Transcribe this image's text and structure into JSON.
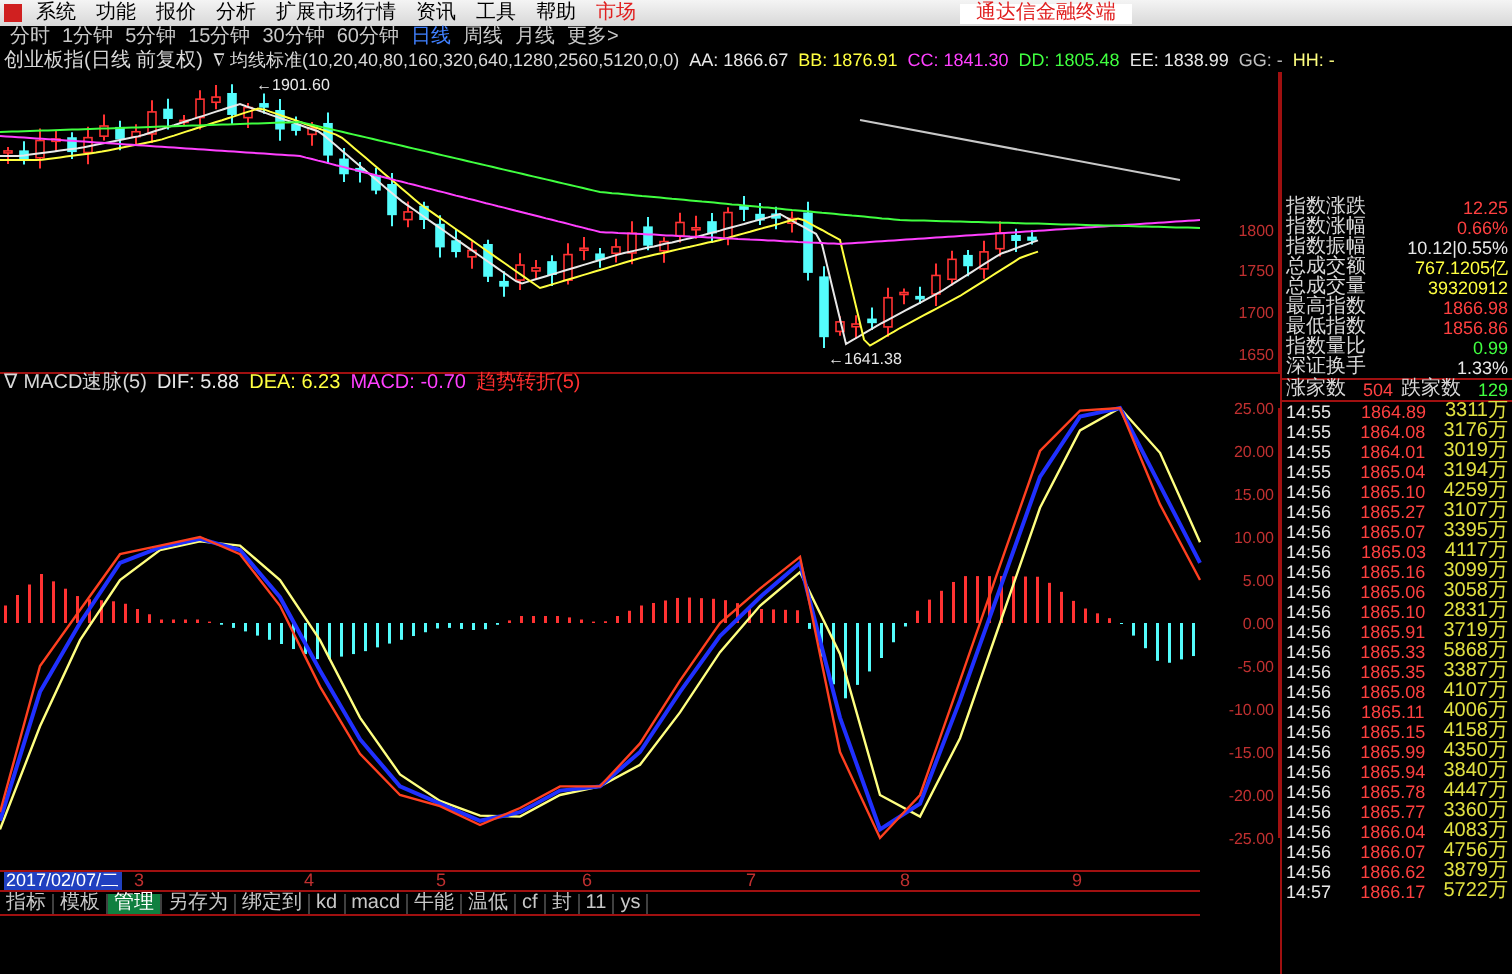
{
  "menu": [
    {
      "label": "系统"
    },
    {
      "label": "功能"
    },
    {
      "label": "报价"
    },
    {
      "label": "分析"
    },
    {
      "label": "扩展市场行情"
    },
    {
      "label": "资讯"
    },
    {
      "label": "工具"
    },
    {
      "label": "帮助"
    }
  ],
  "menu_badge": "市场",
  "brand": "通达信金融终端",
  "periods": [
    {
      "label": "分时",
      "selected": false
    },
    {
      "label": "1分钟",
      "selected": false
    },
    {
      "label": "5分钟",
      "selected": false
    },
    {
      "label": "15分钟",
      "selected": false
    },
    {
      "label": "30分钟",
      "selected": false
    },
    {
      "label": "60分钟",
      "selected": false
    },
    {
      "label": "日线",
      "selected": true
    },
    {
      "label": "周线",
      "selected": false
    },
    {
      "label": "月线",
      "selected": false
    },
    {
      "label": "更多>",
      "selected": false
    }
  ],
  "main_header": {
    "title": "创业板指(日线 前复权)",
    "indicator": "∇ 均线标准(10,20,40,80,160,320,640,1280,2560,5120,0,0)",
    "values": [
      {
        "text": "AA: 1866.67",
        "color": "#e8e8e8"
      },
      {
        "text": "BB: 1876.91",
        "color": "#ffff40"
      },
      {
        "text": "CC: 1841.30",
        "color": "#ff40ff"
      },
      {
        "text": "DD: 1805.48",
        "color": "#40ff40"
      },
      {
        "text": "EE: 1838.99",
        "color": "#e8e8e8"
      },
      {
        "text": "GG: -",
        "color": "#c0c0c0"
      },
      {
        "text": "HH: -",
        "color": "#ffff80"
      }
    ]
  },
  "main_chart": {
    "yticks": [
      "1800",
      "1750",
      "1700",
      "1650"
    ],
    "high_label": "←1901.60",
    "low_label": "←1641.38"
  },
  "macd_header": {
    "title": "∇ MACD速脉(5)",
    "values": [
      {
        "text": "DIF: 5.88",
        "color": "#e8e8e8"
      },
      {
        "text": "DEA: 6.23",
        "color": "#ffff40"
      },
      {
        "text": "MACD: -0.70",
        "color": "#ff40ff"
      },
      {
        "text": "趋势转折(5)",
        "color": "#ff3030"
      }
    ]
  },
  "macd_chart": {
    "chart_data": {
      "type": "line",
      "ylim": [
        -25,
        25
      ],
      "yticks": [
        {
          "value": 25,
          "label": "25.00"
        },
        {
          "value": 20,
          "label": "20.00"
        },
        {
          "value": 15,
          "label": "15.00"
        },
        {
          "value": 10,
          "label": "10.00"
        },
        {
          "value": 5,
          "label": "5.00"
        },
        {
          "value": 0,
          "label": "0.00"
        },
        {
          "value": -5,
          "label": "-5.00"
        },
        {
          "value": -10,
          "label": "-10.00"
        },
        {
          "value": -15,
          "label": "-15.00"
        },
        {
          "value": -20,
          "label": "-20.00"
        },
        {
          "value": -25,
          "label": "-25.00"
        }
      ],
      "series": [
        {
          "color": "#ff4020",
          "values": [
            -22,
            -5,
            1.5,
            8,
            9,
            10,
            8,
            2,
            -7.4,
            -15.2,
            -20,
            -21.3,
            -23.5,
            -21.5,
            -19,
            -19,
            -14,
            -6.7,
            0,
            4,
            7.7,
            -15,
            -25,
            -20,
            -6.7,
            6.7,
            20,
            24.7,
            25,
            13.8,
            5
          ]
        },
        {
          "color": "#2030ff",
          "values": [
            -23,
            -8,
            0,
            7,
            8.8,
            9.8,
            8.5,
            3,
            -5.5,
            -13.5,
            -19,
            -21,
            -23,
            -22,
            -19.5,
            -19,
            -15,
            -8,
            -1.5,
            3,
            7,
            -11,
            -24,
            -21,
            -9,
            4,
            17,
            24,
            25,
            16,
            7
          ]
        },
        {
          "color": "#ffff80",
          "values": [
            -24,
            -12,
            -2,
            5,
            8.5,
            9.5,
            9,
            5,
            -2,
            -11,
            -17.6,
            -20.7,
            -22.4,
            -22.5,
            -20,
            -19,
            -16.5,
            -10.4,
            -3.4,
            2,
            5.9,
            -3.6,
            -20,
            -22.5,
            -13.4,
            0,
            13.4,
            22.4,
            25,
            19.8,
            9.4
          ]
        }
      ]
    }
  },
  "date_axis": [
    {
      "label": "2017/02/07/二",
      "selected": true
    },
    {
      "label": "3",
      "selected": false
    },
    {
      "label": "4",
      "selected": false
    },
    {
      "label": "5",
      "selected": false
    },
    {
      "label": "6",
      "selected": false
    },
    {
      "label": "7",
      "selected": false
    },
    {
      "label": "8",
      "selected": false
    },
    {
      "label": "9",
      "selected": false
    }
  ],
  "bottom_tabs": [
    {
      "label": "指标",
      "selected": false
    },
    {
      "label": "模板",
      "selected": false
    },
    {
      "label": "管理",
      "selected": true
    },
    {
      "label": "另存为",
      "selected": false
    },
    {
      "label": "绑定到",
      "selected": false
    },
    {
      "label": "kd",
      "selected": false
    },
    {
      "label": "macd",
      "selected": false
    },
    {
      "label": "牛能",
      "selected": false
    },
    {
      "label": "温低",
      "selected": false
    },
    {
      "label": "cf",
      "selected": false
    },
    {
      "label": "封",
      "selected": false
    },
    {
      "label": "11",
      "selected": false
    },
    {
      "label": "ys",
      "selected": false
    }
  ],
  "stats": [
    {
      "label": "指数涨跌",
      "value": "12.25",
      "color": "#ff4040"
    },
    {
      "label": "指数涨幅",
      "value": "0.66%",
      "color": "#ff4040"
    },
    {
      "label": "指数振幅",
      "value": "10.12|0.55%",
      "color": "#e8e8e8"
    },
    {
      "label": "总成交额",
      "value": "767.1205亿",
      "color": "#ffff40"
    },
    {
      "label": "总成交量",
      "value": "39320912",
      "color": "#ffff40"
    },
    {
      "label": "最高指数",
      "value": "1866.98",
      "color": "#ff4040"
    },
    {
      "label": "最低指数",
      "value": "1856.86",
      "color": "#ff4040"
    },
    {
      "label": "指数量比",
      "value": "0.99",
      "color": "#40ff40"
    },
    {
      "label": "深证换手",
      "value": "1.33%",
      "color": "#e8e8e8"
    }
  ],
  "breadth": {
    "up_label": "涨家数",
    "up": "504",
    "down_label": "跌家数",
    "down": "129"
  },
  "ticks": [
    {
      "time": "14:55",
      "price": "1864.89",
      "volume": "3311万"
    },
    {
      "time": "14:55",
      "price": "1864.08",
      "volume": "3176万"
    },
    {
      "time": "14:55",
      "price": "1864.01",
      "volume": "3019万"
    },
    {
      "time": "14:55",
      "price": "1865.04",
      "volume": "3194万"
    },
    {
      "time": "14:56",
      "price": "1865.10",
      "volume": "4259万"
    },
    {
      "time": "14:56",
      "price": "1865.27",
      "volume": "3107万"
    },
    {
      "time": "14:56",
      "price": "1865.07",
      "volume": "3395万"
    },
    {
      "time": "14:56",
      "price": "1865.03",
      "volume": "4117万"
    },
    {
      "time": "14:56",
      "price": "1865.16",
      "volume": "3099万"
    },
    {
      "time": "14:56",
      "price": "1865.06",
      "volume": "3058万"
    },
    {
      "time": "14:56",
      "price": "1865.10",
      "volume": "2831万"
    },
    {
      "time": "14:56",
      "price": "1865.91",
      "volume": "3719万"
    },
    {
      "time": "14:56",
      "price": "1865.33",
      "volume": "5868万"
    },
    {
      "time": "14:56",
      "price": "1865.35",
      "volume": "3387万"
    },
    {
      "time": "14:56",
      "price": "1865.08",
      "volume": "4107万"
    },
    {
      "time": "14:56",
      "price": "1865.11",
      "volume": "4006万"
    },
    {
      "time": "14:56",
      "price": "1865.15",
      "volume": "4158万"
    },
    {
      "time": "14:56",
      "price": "1865.99",
      "volume": "4350万"
    },
    {
      "time": "14:56",
      "price": "1865.94",
      "volume": "3840万"
    },
    {
      "time": "14:56",
      "price": "1865.78",
      "volume": "4447万"
    },
    {
      "time": "14:56",
      "price": "1865.77",
      "volume": "3360万"
    },
    {
      "time": "14:56",
      "price": "1866.04",
      "volume": "4083万"
    },
    {
      "time": "14:56",
      "price": "1866.07",
      "volume": "4756万"
    },
    {
      "time": "14:56",
      "price": "1866.62",
      "volume": "3879万"
    },
    {
      "time": "14:57",
      "price": "1866.17",
      "volume": "5722万"
    }
  ]
}
